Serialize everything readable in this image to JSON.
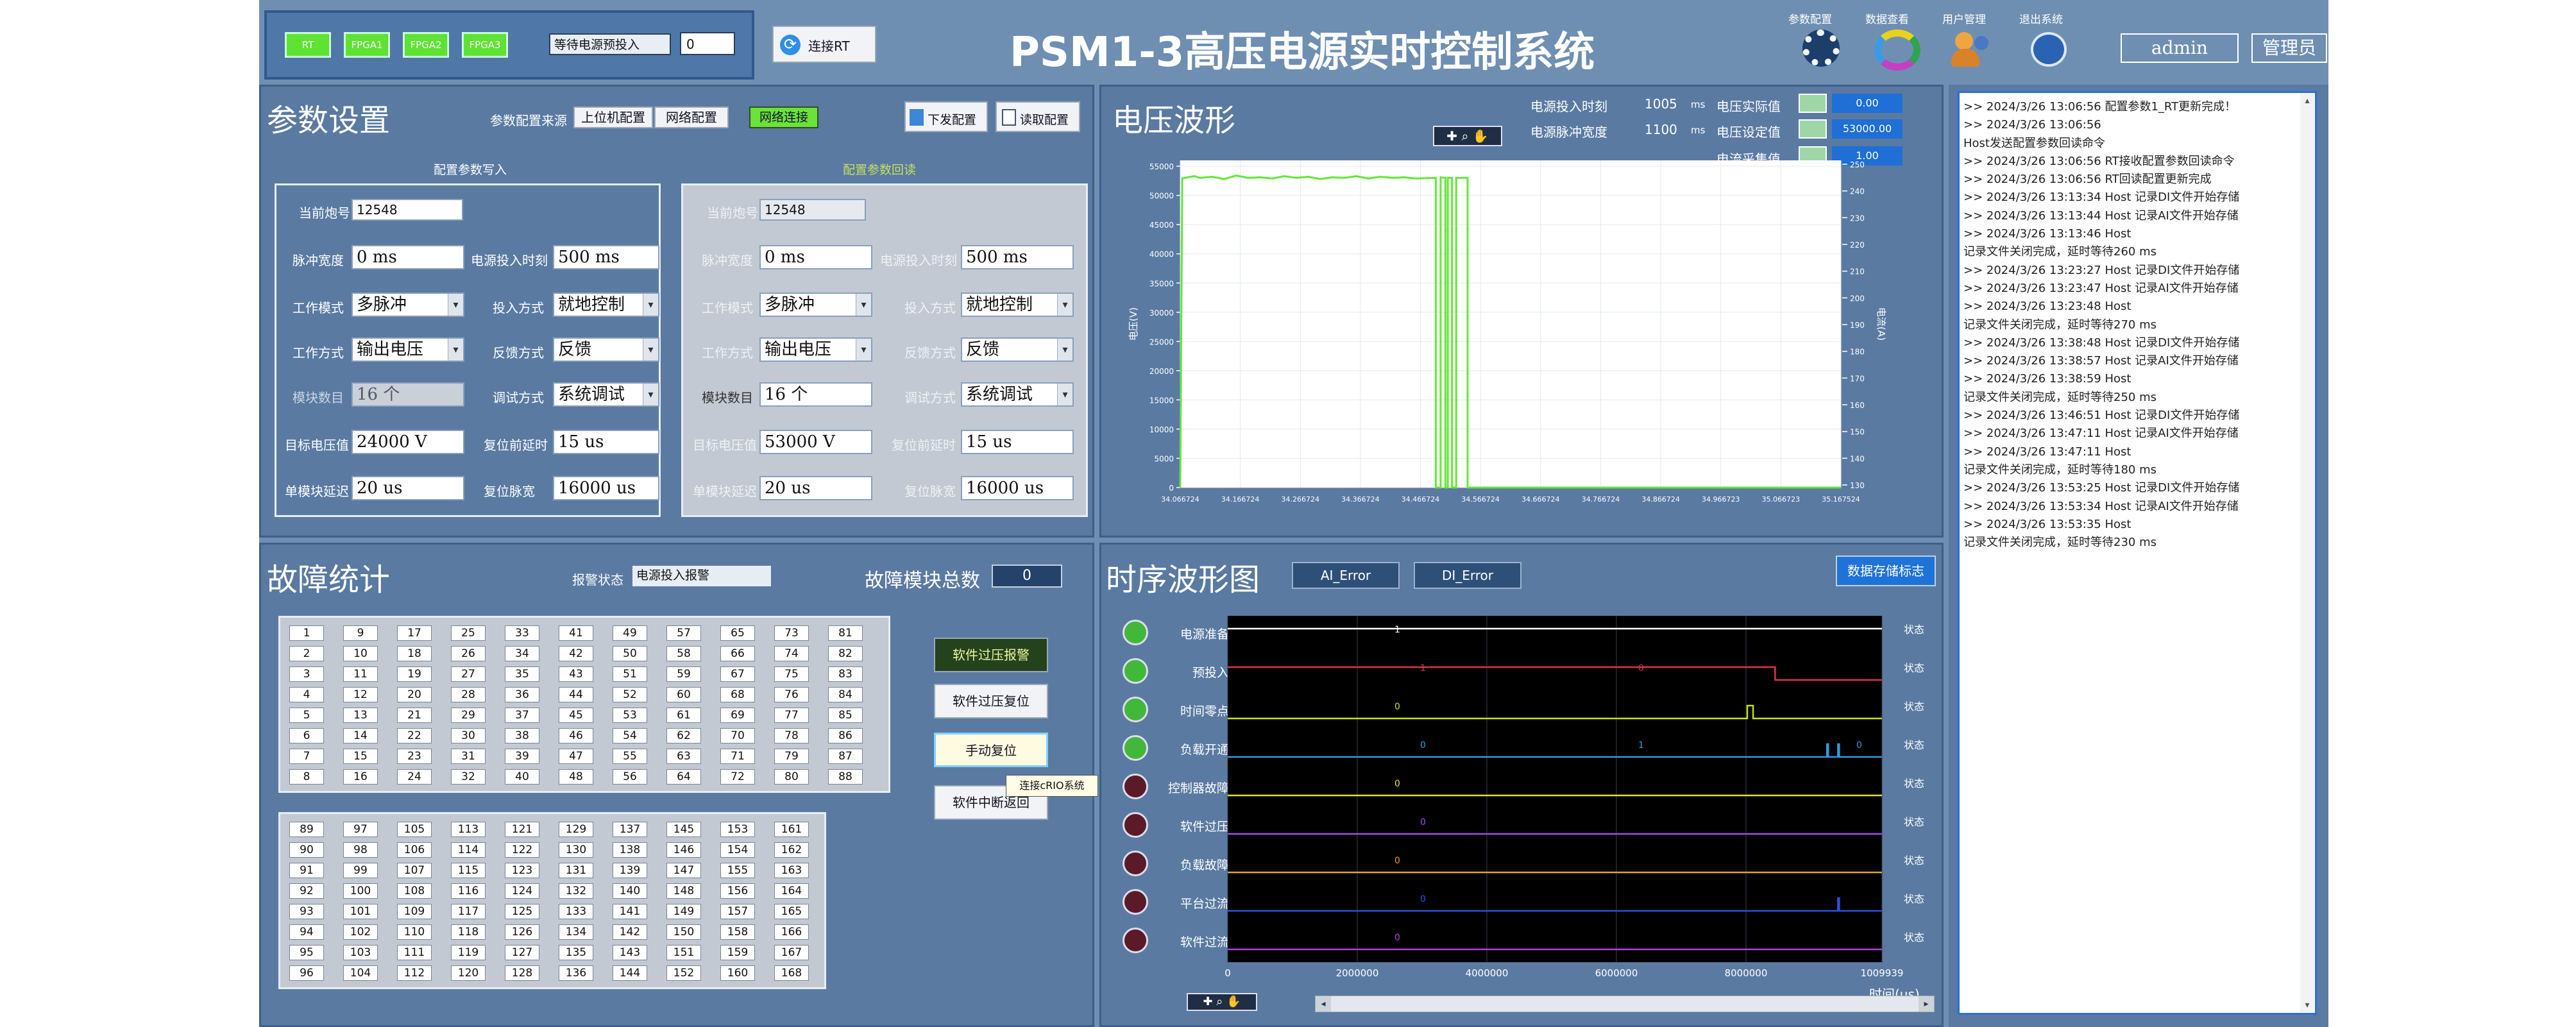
{
  "header": {
    "indicators": [
      "RT",
      "FPGA1",
      "FPGA2",
      "FPGA3"
    ],
    "wait_label": "等待电源预投入",
    "wait_value": "0",
    "connect_button": "连接RT",
    "title": "PSM1-3高压电源实时控制系统",
    "nav": [
      "参数配置",
      "数据查看",
      "用户管理",
      "退出系统"
    ],
    "user": "admin",
    "role": "管理员"
  },
  "params": {
    "title": "参数设置",
    "source_label": "参数配置来源",
    "source_tabs": [
      "上位机配置",
      "网络配置"
    ],
    "net_status": "网络连接",
    "send_button": "下发配置",
    "read_button": "读取配置",
    "write_section": "配置参数写入",
    "readback_section": "配置参数回读",
    "write": {
      "shot_label": "当前炮号",
      "shot": "12548",
      "pulse_width_label": "脉冲宽度",
      "pulse_width": "0 ms",
      "power_on_time_label": "电源投入时刻",
      "power_on_time": "500 ms",
      "work_mode_label": "工作模式",
      "work_mode": "多脉冲",
      "input_mode_label": "投入方式",
      "input_mode": "就地控制",
      "work_type_label": "工作方式",
      "work_type": "输出电压",
      "feedback_label": "反馈方式",
      "feedback": "反馈",
      "module_count_label": "模块数目",
      "module_count": "16 个",
      "debug_label": "调试方式",
      "debug": "系统调试",
      "target_voltage_label": "目标电压值",
      "target_voltage": "24000 V",
      "reset_delay_label": "复位前延时",
      "reset_delay": "15 us",
      "module_delay_label": "单模块延迟",
      "module_delay": "20 us",
      "reset_count_label": "复位脉宽",
      "reset_count": "16000 us"
    },
    "readback": {
      "shot_label": "当前炮号",
      "shot": "12548",
      "pulse_width_label": "脉冲宽度",
      "pulse_width": "0 ms",
      "power_on_time_label": "电源投入时刻",
      "power_on_time": "500 ms",
      "work_mode_label": "工作模式",
      "work_mode": "多脉冲",
      "input_mode_label": "投入方式",
      "input_mode": "就地控制",
      "work_type_label": "工作方式",
      "work_type": "输出电压",
      "feedback_label": "反馈方式",
      "feedback": "反馈",
      "module_count_label": "模块数目",
      "module_count": "16 个",
      "debug_label": "调试方式",
      "debug": "系统调试",
      "target_voltage_label": "目标电压值",
      "target_voltage": "53000 V",
      "reset_delay_label": "复位前延时",
      "reset_delay": "15 us",
      "module_delay_label": "单模块延迟",
      "module_delay": "20 us",
      "reset_count_label": "复位脉宽",
      "reset_count": "16000 us"
    }
  },
  "voltage": {
    "title": "电压波形",
    "power_on_time_label": "电源投入时刻",
    "power_on_time": "1005",
    "power_on_unit": "ms",
    "pulse_width_label": "电源脉冲宽度",
    "pulse_width": "1100",
    "pulse_unit": "ms",
    "actual_label": "电压实际值",
    "actual_value": "0.00",
    "set_label": "电压设定值",
    "set_value": "53000.00",
    "sample_label": "电流采集值",
    "sample_value": "1.00",
    "ylabel_left": "电压(V)",
    "ylabel_right": "电流(A)"
  },
  "faults": {
    "title": "故障统计",
    "alarm_label": "报警状态",
    "alarm_value": "电源投入报警",
    "count_label": "故障模块总数",
    "count_value": "0",
    "buttons": [
      "软件过压报警",
      "软件过压复位",
      "手动复位",
      "软件中断返回"
    ],
    "tooltip": "连接cRIO系统"
  },
  "timing": {
    "title": "时序波形图",
    "tabs": [
      "AI_Error",
      "DI_Error"
    ],
    "save_button": "数据存储标志",
    "signals": [
      "电源准备",
      "预投入",
      "时间零点",
      "负载开通",
      "控制器故障",
      "软件过压",
      "负载故障",
      "平台过流",
      "软件过流"
    ],
    "light_states": [
      "on",
      "on",
      "on",
      "on",
      "off",
      "off",
      "off",
      "off",
      "off"
    ],
    "xlabel": "时间(us)",
    "ylabel": "状态"
  },
  "log": {
    "lines": [
      ">>  2024/3/26 13:06:56      配置参数1_RT更新完成！",
      ">>  2024/3/26 13:06:56",
      "Host发送配置参数回读命令",
      ">>  2024/3/26 13:06:56      RT接收配置参数回读命令",
      ">>  2024/3/26 13:06:56      RT回读配置更新完成",
      ">>  2024/3/26 13:13:34      Host 记录DI文件开始存储",
      ">>  2024/3/26 13:13:44      Host 记录AI文件开始存储",
      ">>  2024/3/26 13:13:46      Host",
      "记录文件关闭完成，延时等待260 ms",
      ">>  2024/3/26 13:23:27      Host 记录DI文件开始存储",
      ">>  2024/3/26 13:23:47      Host 记录AI文件开始存储",
      ">>  2024/3/26 13:23:48      Host",
      "记录文件关闭完成，延时等待270 ms",
      ">>  2024/3/26 13:38:48      Host 记录DI文件开始存储",
      ">>  2024/3/26 13:38:57      Host 记录AI文件开始存储",
      ">>  2024/3/26 13:38:59      Host",
      "记录文件关闭完成，延时等待250 ms",
      ">>  2024/3/26 13:46:51      Host 记录DI文件开始存储",
      ">>  2024/3/26 13:47:11      Host 记录AI文件开始存储",
      ">>  2024/3/26 13:47:11      Host",
      "记录文件关闭完成，延时等待180 ms",
      ">>  2024/3/26 13:53:25      Host 记录DI文件开始存储",
      ">>  2024/3/26 13:53:34      Host 记录AI文件开始存储",
      ">>  2024/3/26 13:53:35      Host",
      "记录文件关闭完成，延时等待230 ms"
    ]
  },
  "chart_data": [
    {
      "type": "line",
      "x_ticks": [
        "34.066724",
        "34.166724",
        "34.266724",
        "34.366724",
        "34.466724",
        "34.566724",
        "34.666724",
        "34.766724",
        "34.866724",
        "34.966723",
        "35.066723",
        "35.167524"
      ],
      "y_ticks": [
        0,
        5000,
        10000,
        15000,
        20000,
        25000,
        30000,
        35000,
        40000,
        45000,
        50000,
        55000
      ],
      "y2_ticks": [
        130,
        140,
        150,
        160,
        170,
        180,
        190,
        200,
        210,
        220,
        230,
        240,
        250
      ],
      "ylim": [
        0,
        56000
      ],
      "xlim": [
        34.066724,
        35.167524
      ],
      "series": [
        {
          "values_x": [
            34.0667,
            34.07,
            34.09,
            34.1,
            34.12,
            34.14,
            34.16,
            34.18,
            34.2,
            34.22,
            34.24,
            34.26,
            34.28,
            34.3,
            34.32,
            34.34,
            34.36,
            34.38,
            34.4,
            34.42,
            34.44,
            34.46,
            34.4925,
            34.4925,
            34.5005,
            34.5005,
            34.5085,
            34.5085,
            34.5125,
            34.5125,
            34.5195,
            34.5195,
            34.5265,
            34.5265,
            34.5335,
            34.5335,
            34.5455,
            34.5455,
            34.7,
            35.0,
            35.1675
          ],
          "values_y": [
            0,
            52900,
            53300,
            53000,
            53200,
            52800,
            53400,
            53000,
            53100,
            52900,
            53300,
            53000,
            53200,
            52800,
            53100,
            53000,
            53300,
            52900,
            53200,
            53000,
            53100,
            52900,
            53000,
            0,
            0,
            53100,
            53000,
            0,
            0,
            53000,
            53000,
            0,
            0,
            53000,
            53000,
            53000,
            53000,
            0,
            0,
            0,
            0
          ],
          "color": "#62e834"
        }
      ]
    },
    {
      "type": "line",
      "xlim": [
        0,
        10099390
      ],
      "x_ticks": [
        0,
        2000000,
        4000000,
        6000000,
        8000000,
        10099390
      ],
      "x_tick_labels": [
        "0",
        "2000000",
        "4000000",
        "6000000",
        "8000000",
        "1009939"
      ],
      "series": [
        {
          "name": "电源准备",
          "values_x": [
            0,
            10099390
          ],
          "values_y": [
            1,
            1
          ],
          "value_label": "1",
          "color": "#ffffff"
        },
        {
          "name": "预投入",
          "values_x": [
            0,
            8450000,
            8450000,
            10099390
          ],
          "values_y": [
            1,
            1,
            0,
            0
          ],
          "value_label": "1 0",
          "color": "#e0304a"
        },
        {
          "name": "时间零点",
          "values_x": [
            0,
            8020000,
            8020000,
            8110000,
            8110000,
            10099390
          ],
          "values_y": [
            0,
            0,
            1,
            1,
            0,
            0
          ],
          "value_label": "0",
          "color": "#c8e000"
        },
        {
          "name": "负载开通",
          "values_x": [
            0,
            9250000,
            9250000,
            9270000,
            9270000,
            9420000,
            9420000,
            9440000,
            9440000,
            10099390
          ],
          "values_y": [
            0,
            0,
            1,
            1,
            0,
            0,
            1,
            1,
            0,
            0
          ],
          "value_label": "0 1 0",
          "color": "#2e9ae0"
        },
        {
          "name": "控制器故障",
          "values_x": [
            0,
            10099390
          ],
          "values_y": [
            0,
            0
          ],
          "value_label": "0",
          "color": "#e6e02a"
        },
        {
          "name": "软件过压",
          "values_x": [
            0,
            10099390
          ],
          "values_y": [
            0,
            0
          ],
          "value_label": "0",
          "color": "#9a50e8"
        },
        {
          "name": "负载故障",
          "values_x": [
            0,
            10099390
          ],
          "values_y": [
            0,
            0
          ],
          "value_label": "0",
          "color": "#e0a030"
        },
        {
          "name": "平台过流",
          "values_x": [
            0,
            9420000,
            9420000,
            9440000,
            9440000,
            10099390
          ],
          "values_y": [
            0,
            0,
            1,
            1,
            0,
            0
          ],
          "value_label": "0",
          "color": "#2a50e0"
        },
        {
          "name": "软件过流",
          "values_x": [
            0,
            10099390
          ],
          "values_y": [
            0,
            0
          ],
          "value_label": "0",
          "color": "#b040e0"
        }
      ]
    }
  ]
}
